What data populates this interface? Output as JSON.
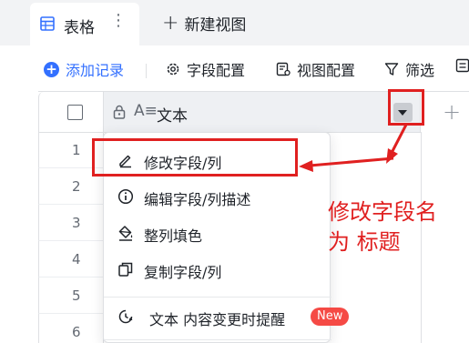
{
  "view_tabs": {
    "active_tab_label": "表格",
    "active_tab_more": "⋮",
    "new_view_label": "新建视图"
  },
  "toolbar": {
    "add_record_label": "添加记录",
    "field_config_label": "字段配置",
    "view_config_label": "视图配置",
    "filter_label": "筛选"
  },
  "grid": {
    "field_name": "文本",
    "add_column": "+",
    "row_numbers": [
      "1",
      "2",
      "3",
      "4",
      "5",
      "6"
    ]
  },
  "field_menu": {
    "items": [
      {
        "label": "修改字段/列",
        "icon": "pencil-icon"
      },
      {
        "label": "编辑字段/列描述",
        "icon": "info-icon"
      },
      {
        "label": "整列填色",
        "icon": "paint-bucket-icon"
      },
      {
        "label": "复制字段/列",
        "icon": "copy-icon"
      },
      {
        "label": "文本 内容变更时提醒",
        "icon": "clock-bell-icon",
        "badge": "New"
      }
    ]
  },
  "annotation": {
    "text": "修改字段名\n为 标题"
  },
  "colors": {
    "accent": "#3370ff",
    "annotation_red": "#e02020",
    "badge_red": "#f54a45",
    "header_bg": "#eef0f3"
  }
}
